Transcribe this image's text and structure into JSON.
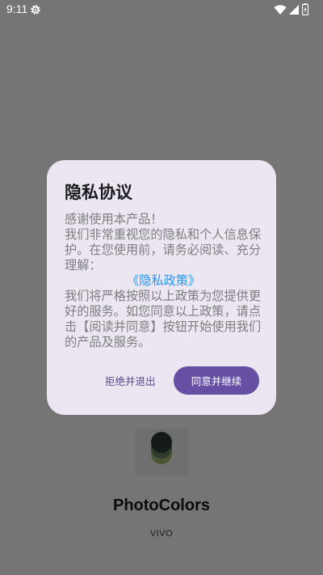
{
  "status_bar": {
    "time": "9:11",
    "icons": [
      "gear-icon",
      "wifi-icon",
      "signal-icon",
      "battery-icon"
    ]
  },
  "app": {
    "name": "PhotoColors",
    "brand": "VIVO",
    "icon": "color-stack-icon"
  },
  "dialog": {
    "title": "隐私协议",
    "body": {
      "line1": "感谢使用本产品！",
      "line2": "我们非常重视您的隐私和个人信息保护。在您使用前，请务必阅读、充分理解：",
      "link": "《隐私政策》",
      "line3": "我们将严格按照以上政策为您提供更好的服务。如您同意以上政策，请点击【阅读并同意】按钮开始使用我们的产品及服务。"
    },
    "decline_label": "拒绝并退出",
    "accept_label": "同意并继续"
  },
  "colors": {
    "scrim": "#757575",
    "dialog_bg": "#ece6f2",
    "accent": "#6550a4",
    "link": "#2196f3"
  }
}
